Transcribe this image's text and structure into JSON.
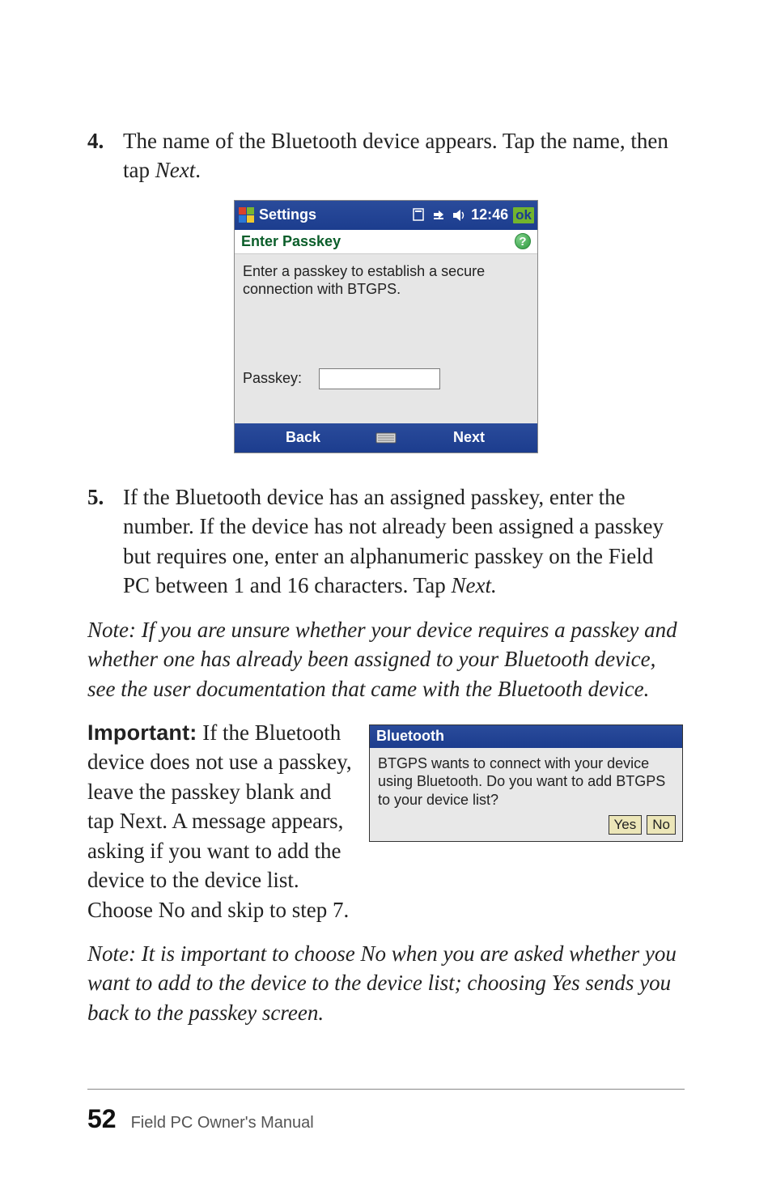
{
  "step4": {
    "num": "4.",
    "text_a": "The name of the Bluetooth device appears. Tap the name, then tap ",
    "text_em": "Next",
    "text_b": "."
  },
  "screenshot": {
    "title": "Settings",
    "time": "12:46",
    "ok": "ok",
    "subtitle": "Enter Passkey",
    "help": "?",
    "message": "Enter a passkey to establish a secure connection with BTGPS.",
    "passkey_label": "Passkey:",
    "back": "Back",
    "next": "Next"
  },
  "step5": {
    "num": "5.",
    "text_a": "If the Bluetooth device has an assigned passkey, enter the number. If the device has not already been assigned a passkey but requires one, enter an alphanumeric passkey on the Field PC between 1 and 16 characters. Tap ",
    "text_em": "Next.",
    "text_b": ""
  },
  "note1": "Note: If you are unsure whether your device requires a passkey and whether one has already been assigned to your Bluetooth device, see the user documentation that came with the Bluetooth device.",
  "important": {
    "label": "Important:",
    "text": "  If the Bluetooth device does not use a passkey, leave the passkey blank and tap Next. A message appears, asking if you want to add the device to the device list. Choose No and skip to step 7."
  },
  "dialog": {
    "title": "Bluetooth",
    "body": "BTGPS wants to connect with your device using Bluetooth. Do you want to add BTGPS to your device list?",
    "yes": "Yes",
    "no": "No"
  },
  "note2": "Note: It is important to choose No when you are asked whether you want to add to the device to the device list; choosing Yes sends you back to the passkey screen.",
  "footer": {
    "page": "52",
    "title": "Field PC Owner's Manual"
  }
}
